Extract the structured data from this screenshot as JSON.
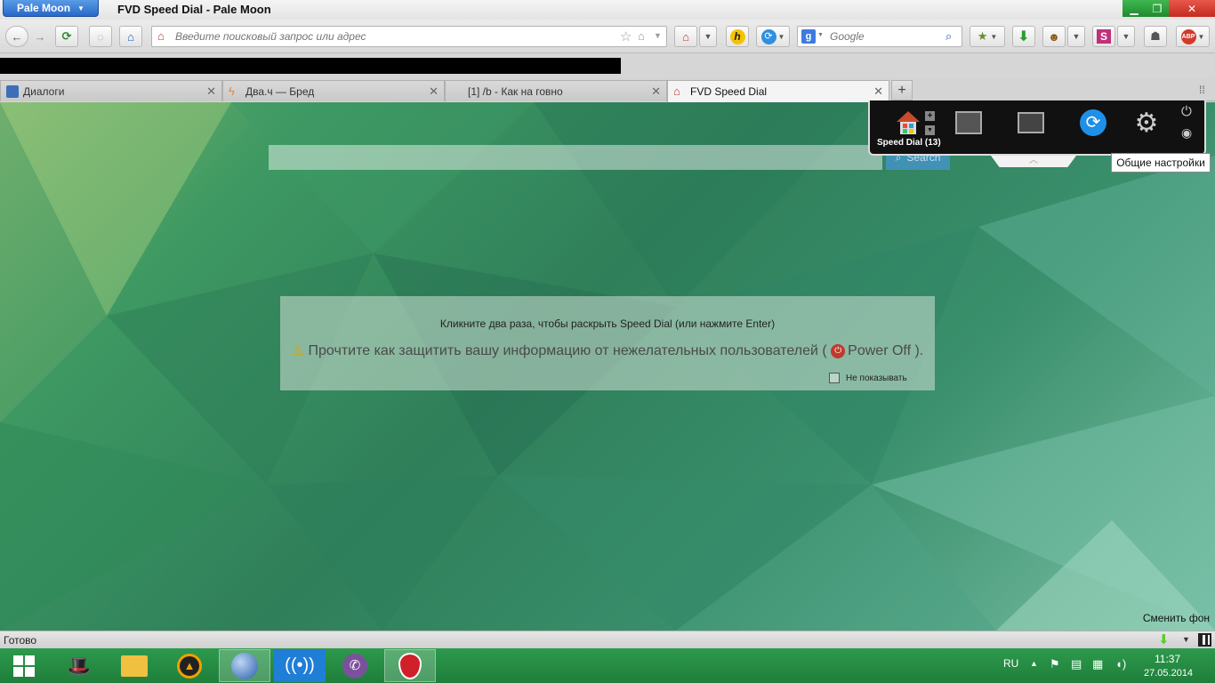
{
  "window": {
    "app_menu_label": "Pale Moon",
    "title": "FVD Speed Dial - Pale Moon"
  },
  "navbar": {
    "url_placeholder": "Введите поисковый запрос или адрес",
    "search_placeholder": "Google"
  },
  "tabs": [
    {
      "title": "Диалоги"
    },
    {
      "title": "Два.ч — Бред"
    },
    {
      "title": "[1] /b - Как на говно"
    },
    {
      "title": "FVD Speed Dial"
    }
  ],
  "speed_dial": {
    "search_button": "Search",
    "panel_label": "Speed Dial (13)",
    "tooltip": "Общие настройки",
    "notice_line1": "Кликните два раза, чтобы раскрыть Speed Dial (или нажмите Enter)",
    "notice_line2": "Прочтите как защитить вашу информацию от нежелательных пользователей (",
    "power_off": "Power Off",
    "notice_end": ").",
    "dont_show": "Не показывать",
    "change_bg": "Сменить фон"
  },
  "status": {
    "text": "Готово"
  },
  "taskbar": {
    "lang": "RU",
    "time": "11:37",
    "date": "27.05.2014"
  }
}
